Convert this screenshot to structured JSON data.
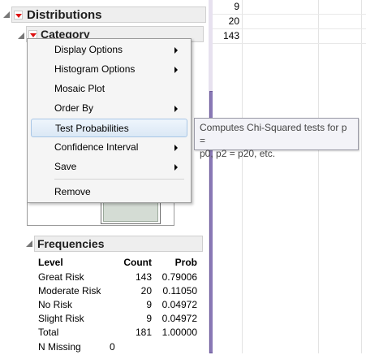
{
  "distributions": {
    "title": "Distributions"
  },
  "category": {
    "title": "Category"
  },
  "grid": {
    "values": [
      "9",
      "20",
      "143"
    ]
  },
  "menu": {
    "items": [
      {
        "label": "Display Options",
        "submenu": true
      },
      {
        "label": "Histogram Options",
        "submenu": true
      },
      {
        "label": "Mosaic Plot",
        "submenu": false
      },
      {
        "label": "Order By",
        "submenu": true
      },
      {
        "label": "Test Probabilities",
        "submenu": false,
        "highlighted": true
      },
      {
        "label": "Confidence Interval",
        "submenu": true
      },
      {
        "label": "Save",
        "submenu": true
      },
      {
        "label": "Remove",
        "submenu": false
      }
    ]
  },
  "tooltip": {
    "line1": "Computes Chi-Squared tests for p =",
    "line2": "p0, p2 = p20, etc."
  },
  "frequencies": {
    "title": "Frequencies",
    "headers": {
      "level": "Level",
      "count": "Count",
      "prob": "Prob"
    },
    "rows": [
      {
        "level": "Great Risk",
        "count": "143",
        "prob": "0.79006"
      },
      {
        "level": "Moderate Risk",
        "count": "20",
        "prob": "0.11050"
      },
      {
        "level": "No Risk",
        "count": "9",
        "prob": "0.04972"
      },
      {
        "level": "Slight Risk",
        "count": "9",
        "prob": "0.04972"
      },
      {
        "level": "Total",
        "count": "181",
        "prob": "1.00000"
      }
    ],
    "missing": {
      "label": "N Missing",
      "value": "0"
    }
  },
  "colors": {
    "scroll_thumb": "#8a79b6",
    "hover_border": "#a8c6e6",
    "red_triangle": "#dd1111"
  }
}
